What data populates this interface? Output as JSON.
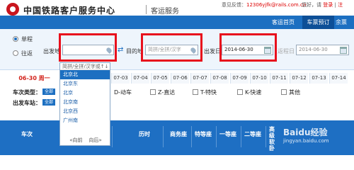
{
  "header": {
    "site_title": "中国铁路客户服务中心",
    "section_title": "客运服务",
    "feedback_label": "意见反馈：",
    "feedback_email": "12306yjfk@rails.com.cn",
    "greeting": "您好，请",
    "login": "登录",
    "register": "注"
  },
  "nav": {
    "items": [
      {
        "label": "客运首页",
        "active": false
      },
      {
        "label": "车票预订",
        "active": true
      },
      {
        "label": "余票",
        "active": false
      }
    ]
  },
  "search": {
    "trip_types": [
      {
        "label": "单程",
        "selected": true
      },
      {
        "label": "往返",
        "selected": false
      }
    ],
    "from_label": "出发地",
    "from_value": "",
    "to_label": "目的地",
    "to_placeholder": "简拼/全拼/汉字",
    "depart_label": "出发日",
    "depart_value": "2014-06-30",
    "return_label": "返程日",
    "return_value": "2014-06-30"
  },
  "dropdown": {
    "hint": "简拼/全拼/汉字或↑↓",
    "items": [
      {
        "label": "北京北",
        "selected": true
      },
      {
        "label": "北京东",
        "selected": false
      },
      {
        "label": "北京",
        "selected": false
      },
      {
        "label": "北京南",
        "selected": false
      },
      {
        "label": "北京西",
        "selected": false
      },
      {
        "label": "广州南",
        "selected": false
      }
    ],
    "prev": "«向前",
    "next": "向后»"
  },
  "dates": {
    "current": "06-30 周一",
    "cells": [
      "07-03",
      "07-04",
      "07-05",
      "07-06",
      "07-07",
      "07-08",
      "07-09",
      "07-10",
      "07-11",
      "07-12",
      "07-13",
      "07-14"
    ]
  },
  "filters": {
    "train_type_label": "车次类型：",
    "station_label": "出发车站：",
    "all_label": "全部",
    "train_types": [
      "D-动车",
      "Z-直达",
      "T-特快",
      "K-快速",
      "其他"
    ]
  },
  "table_header": {
    "columns": [
      "车次",
      "历时",
      "商务座",
      "特等座",
      "一等座",
      "二等座",
      "高级软卧"
    ]
  },
  "watermark": {
    "brand": "Baidu经验",
    "url": "jingyan.baidu.com"
  }
}
